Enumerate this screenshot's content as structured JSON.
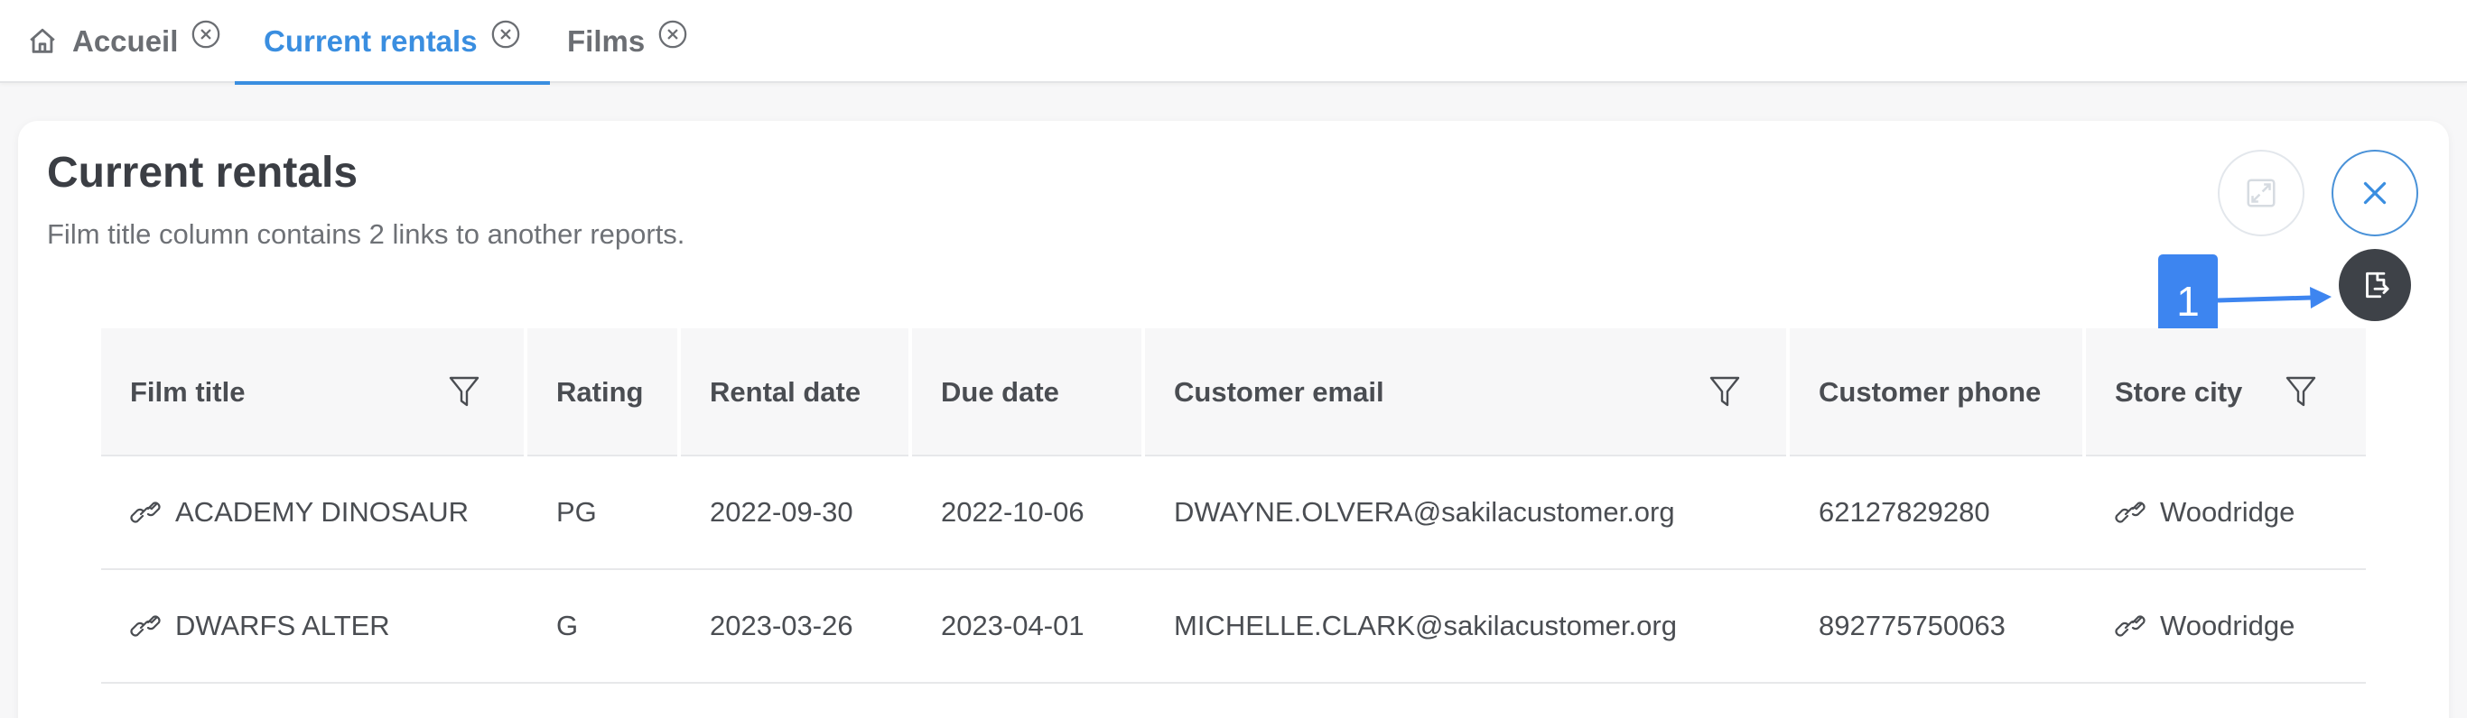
{
  "tabs": [
    {
      "label": "Accueil",
      "icon": "home-icon",
      "active": false
    },
    {
      "label": "Current rentals",
      "active": true
    },
    {
      "label": "Films",
      "active": false
    }
  ],
  "report": {
    "title": "Current rentals",
    "subtitle": "Film title column contains 2 links to another reports."
  },
  "annotation": {
    "number": "1"
  },
  "table": {
    "columns": [
      {
        "label": "Film title",
        "filter": true
      },
      {
        "label": "Rating",
        "filter": false
      },
      {
        "label": "Rental date",
        "filter": false
      },
      {
        "label": "Due date",
        "filter": false
      },
      {
        "label": "Customer email",
        "filter": true
      },
      {
        "label": "Customer phone",
        "filter": false
      },
      {
        "label": "Store city",
        "filter": true
      }
    ],
    "rows": [
      [
        "ACADEMY DINOSAUR",
        "PG",
        "2022-09-30",
        "2022-10-06",
        "DWAYNE.OLVERA@sakilacustomer.org",
        "62127829280",
        "Woodridge"
      ],
      [
        "DWARFS ALTER",
        "G",
        "2023-03-26",
        "2023-04-01",
        "MICHELLE.CLARK@sakilacustomer.org",
        "892775750063",
        "Woodridge"
      ]
    ]
  },
  "colors": {
    "accent": "#3a8ee0",
    "annotation": "#3d85f0",
    "export_button": "#3e4248"
  }
}
